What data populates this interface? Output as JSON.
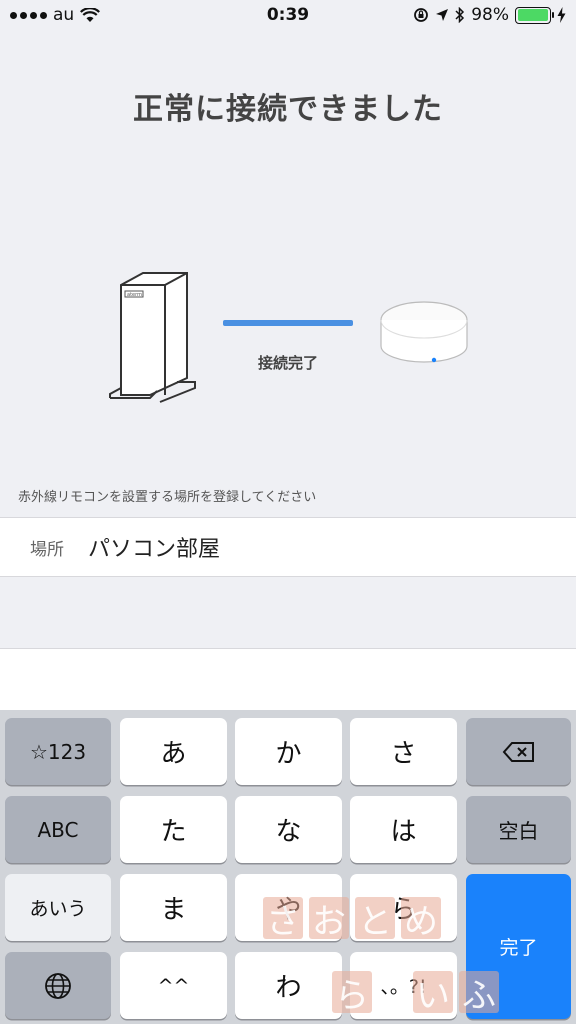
{
  "status_bar": {
    "carrier": "au",
    "time": "0:39",
    "battery_percent": "98%",
    "battery_level": 0.98,
    "battery_color": "#4cd964"
  },
  "title": "正常に接続できました",
  "illustration": {
    "connection_label": "接続完了",
    "line_color": "#4a90e2",
    "router_brand_text": "aterm"
  },
  "instruction": "赤外線リモコンを設置する場所を登録してください",
  "location": {
    "label": "場所",
    "value": "パソコン部屋"
  },
  "keyboard": {
    "row1": [
      "☆123",
      "あ",
      "か",
      "さ"
    ],
    "row2": [
      "ABC",
      "た",
      "な",
      "は",
      "空白"
    ],
    "row3": [
      "あいう",
      "ま",
      "や",
      "ら"
    ],
    "row4": [
      "^^",
      "わ",
      "、。?!"
    ],
    "done_label": "完了",
    "done_color": "#1a82fb"
  },
  "watermark": {
    "chars": [
      "さ",
      "お",
      "と",
      "め",
      "ら",
      "い",
      "ふ"
    ]
  }
}
